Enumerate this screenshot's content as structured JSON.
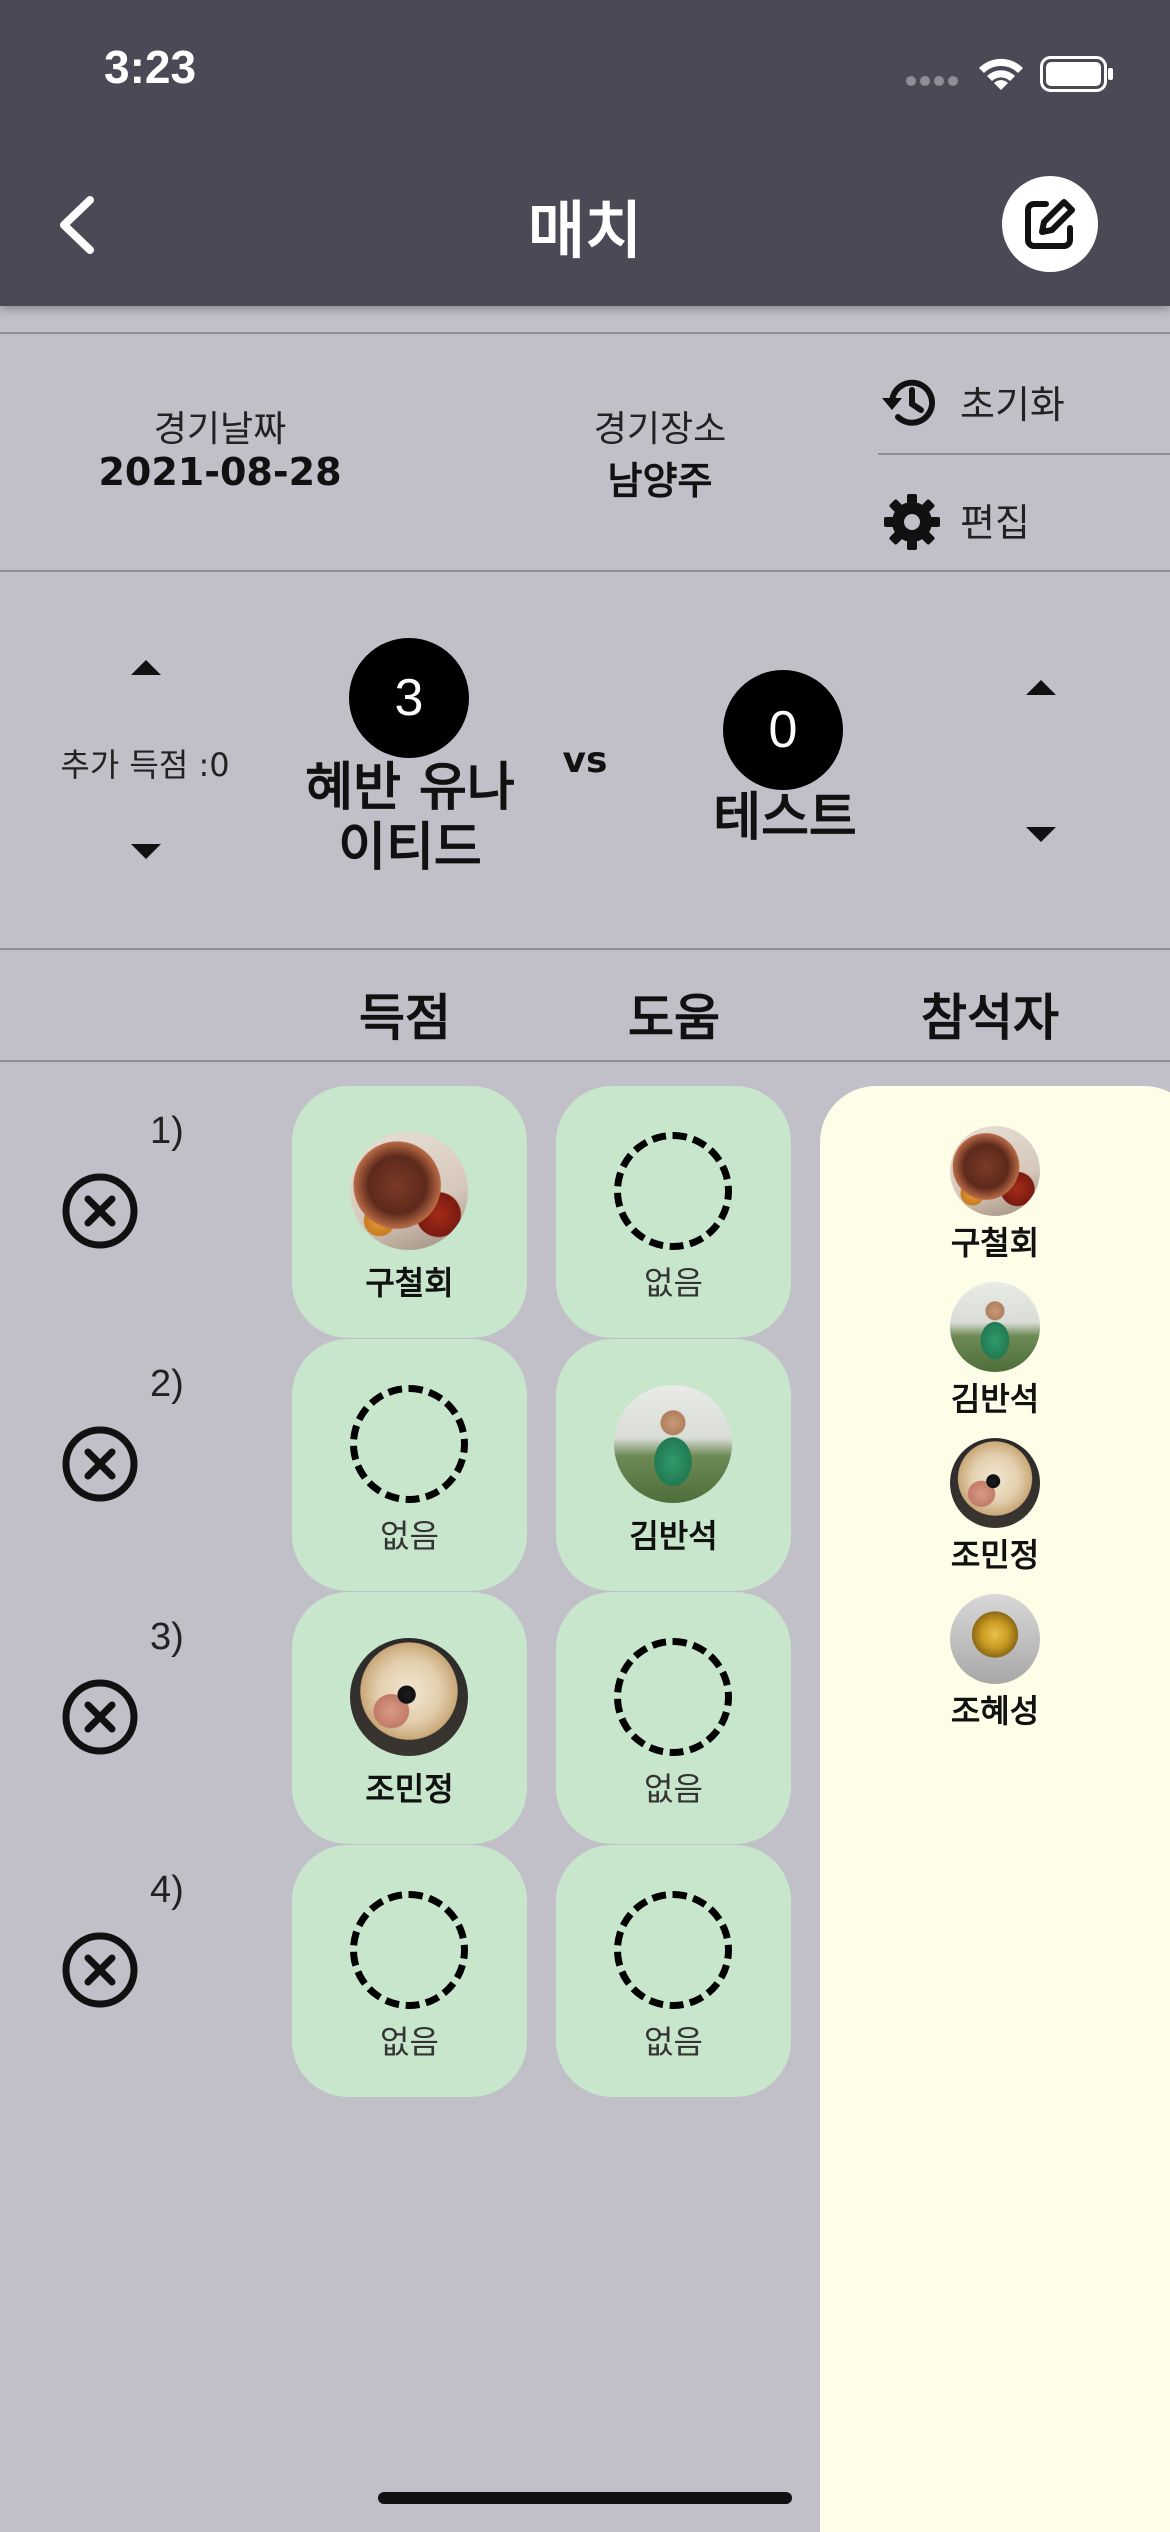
{
  "status_bar": {
    "time": "3:23"
  },
  "nav": {
    "title": "매치",
    "back_icon": "chevron-left-icon",
    "edit_icon": "edit-icon"
  },
  "match_info": {
    "date_label": "경기날짜",
    "date_value": "2021-08-28",
    "location_label": "경기장소",
    "location_value": "남양주",
    "reset_label": "초기화",
    "edit_label": "편집"
  },
  "score": {
    "extra_points_label": "추가 득점 :0",
    "home_score": "3",
    "home_team": "혜반 유나\n이티드",
    "home_team_line1": "혜반 유나",
    "home_team_line2": "이티드",
    "vs": "vs",
    "away_score": "0",
    "away_team": "테스트"
  },
  "columns": {
    "goal": "득점",
    "assist": "도움",
    "attendees": "참석자"
  },
  "events": [
    {
      "num": "1)",
      "goal": "구철회",
      "goal_empty": false,
      "assist": "없음",
      "assist_empty": true
    },
    {
      "num": "2)",
      "goal": "없음",
      "goal_empty": true,
      "assist": "김반석",
      "assist_empty": false
    },
    {
      "num": "3)",
      "goal": "조민정",
      "goal_empty": false,
      "assist": "없음",
      "assist_empty": true
    },
    {
      "num": "4)",
      "goal": "없음",
      "goal_empty": true,
      "assist": "없음",
      "assist_empty": true
    }
  ],
  "attendees": [
    "구철회",
    "김반석",
    "조민정",
    "조혜성"
  ],
  "colors": {
    "header_bg": "#4a4955",
    "page_bg": "#c1c0c8",
    "cell_bg": "#c8e6cc",
    "attendee_bg": "#fefde8"
  }
}
